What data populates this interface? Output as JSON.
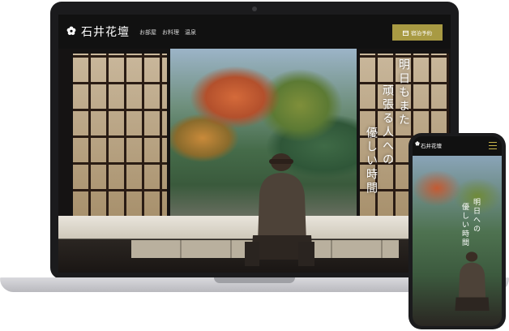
{
  "site": {
    "brand": "石井花壇",
    "nav": [
      "お部屋",
      "お料理",
      "温泉"
    ],
    "reserve_label": "宿泊予約",
    "hero_copy": [
      "明日もまた",
      "頑張る人への",
      "優しい時間"
    ]
  },
  "mobile": {
    "brand": "石井花壇",
    "hero_copy": [
      "明日への",
      "優しい時間"
    ]
  },
  "colors": {
    "accent": "#a89a43",
    "header_bg": "#111111"
  },
  "icons": {
    "logo": "flower-crest-icon",
    "reserve": "calendar-icon",
    "mobile_menu": "hamburger-menu-icon"
  }
}
